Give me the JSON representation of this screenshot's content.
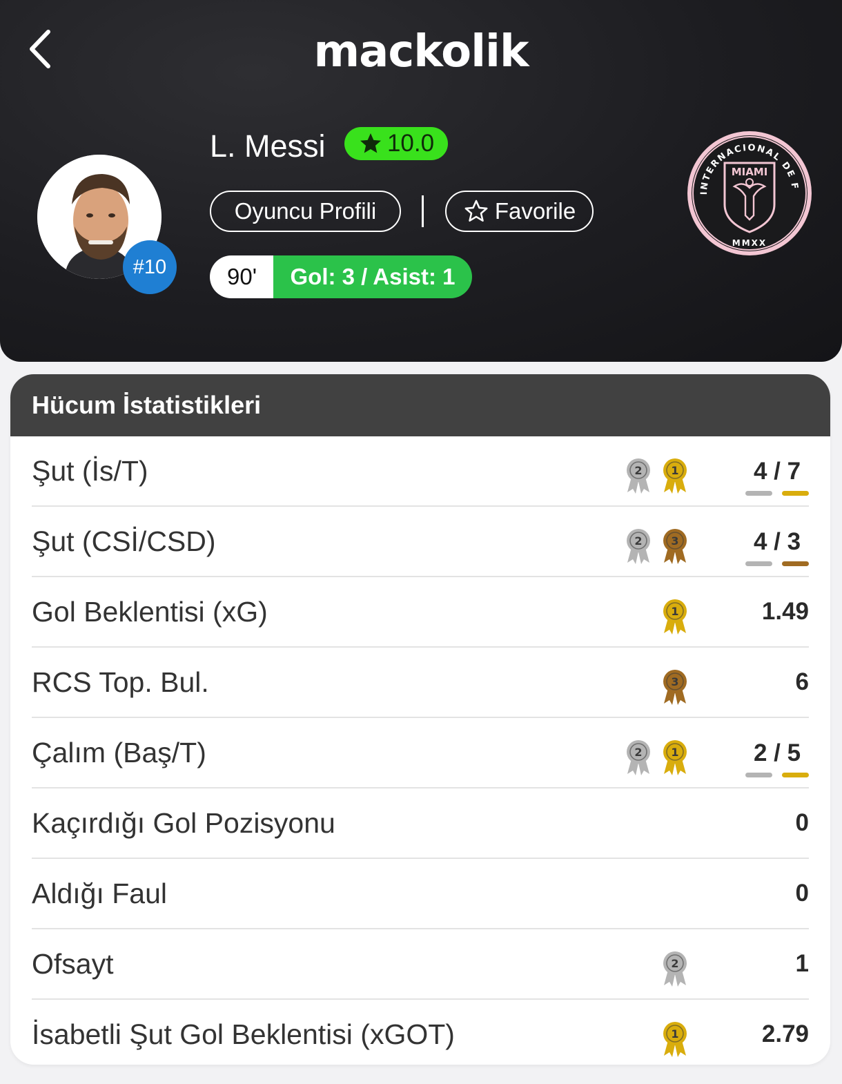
{
  "header": {
    "brand": "mackolik",
    "back_icon": "chevron-left-icon"
  },
  "player": {
    "name": "L. Messi",
    "rating": "10.0",
    "number": "#10",
    "profile_button": "Oyuncu Profili",
    "favorite_button": "Favorile",
    "minutes": "90'",
    "goals_assists": "Gol: 3 / Asist: 1"
  },
  "club_logo": {
    "top_text": "CLUB INTERNACIONAL DE FÚTBOL",
    "name": "MIAMI",
    "year": "MMXX"
  },
  "colors": {
    "rating_green": "#39e11c",
    "goal_green": "#2bc24a",
    "number_blue": "#1f7fd3",
    "gold": "#d9ad0d",
    "silver": "#b4b4b4",
    "bronze": "#a06b22",
    "miami_pink": "#f3c6d3"
  },
  "stats": {
    "title": "Hücum İstatistikleri",
    "rows": [
      {
        "label": "Şut (İs/T)",
        "medals": [
          2,
          1
        ],
        "value_left": "4",
        "value_right": "7",
        "bar_left": "silver",
        "bar_right": "gold"
      },
      {
        "label": "Şut (CSİ/CSD)",
        "medals": [
          2,
          3
        ],
        "value_left": "4",
        "value_right": "3",
        "bar_left": "silver",
        "bar_right": "bronze"
      },
      {
        "label": "Gol Beklentisi (xG)",
        "medals": [
          1
        ],
        "value": "1.49"
      },
      {
        "label": "RCS Top. Bul.",
        "medals": [
          3
        ],
        "value": "6"
      },
      {
        "label": "Çalım (Baş/T)",
        "medals": [
          2,
          1
        ],
        "value_left": "2",
        "value_right": "5",
        "bar_left": "silver",
        "bar_right": "gold"
      },
      {
        "label": "Kaçırdığı Gol Pozisyonu",
        "medals": [],
        "value": "0"
      },
      {
        "label": "Aldığı Faul",
        "medals": [],
        "value": "0"
      },
      {
        "label": "Ofsayt",
        "medals": [
          2
        ],
        "value": "1"
      },
      {
        "label": "İsabetli Şut Gol Beklentisi (xGOT)",
        "medals": [
          1
        ],
        "value": "2.79"
      }
    ]
  }
}
